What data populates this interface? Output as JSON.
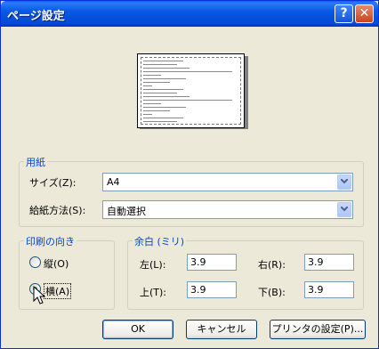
{
  "window": {
    "title": "ページ設定"
  },
  "paper": {
    "legend": "用紙",
    "size_label": "サイズ(Z):",
    "size_value": "A4",
    "source_label": "給紙方法(S):",
    "source_value": "自動選択"
  },
  "orientation": {
    "legend": "印刷の向き",
    "portrait_label": "縦(O)",
    "landscape_label": "横(A)",
    "selected": "landscape"
  },
  "margins": {
    "legend": "余白 (ミリ)",
    "left_label": "左(L):",
    "left_value": "3.9",
    "right_label": "右(R):",
    "right_value": "3.9",
    "top_label": "上(T):",
    "top_value": "3.9",
    "bottom_label": "下(B):",
    "bottom_value": "3.9"
  },
  "buttons": {
    "ok": "OK",
    "cancel": "キャンセル",
    "printer": "プリンタの設定(P)..."
  },
  "colors": {
    "title_bar": "#0a5ef7",
    "group_label": "#0046d5",
    "window_bg": "#ece9d8"
  }
}
